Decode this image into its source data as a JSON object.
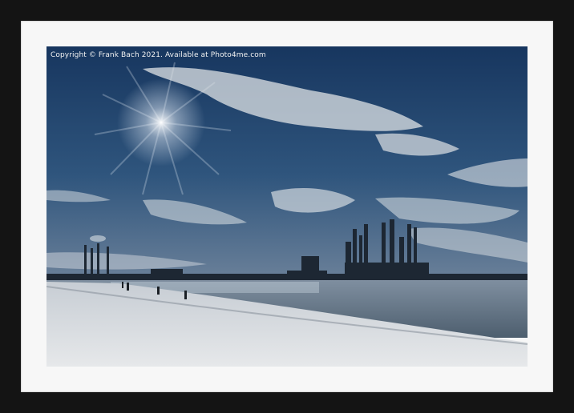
{
  "image": {
    "copyright_text": "Copyright © Frank Bach 2021. Available at Photo4me.com",
    "subject": "beach-with-industrial-skyline-and-oil-rigs",
    "colors": {
      "frame": "#141414",
      "mat": "#f7f7f7",
      "sky_top": "#1c3f6e",
      "sky_bottom": "#4d6d8d",
      "sea": "#5c6f80",
      "sand": "#d9dde2"
    }
  }
}
